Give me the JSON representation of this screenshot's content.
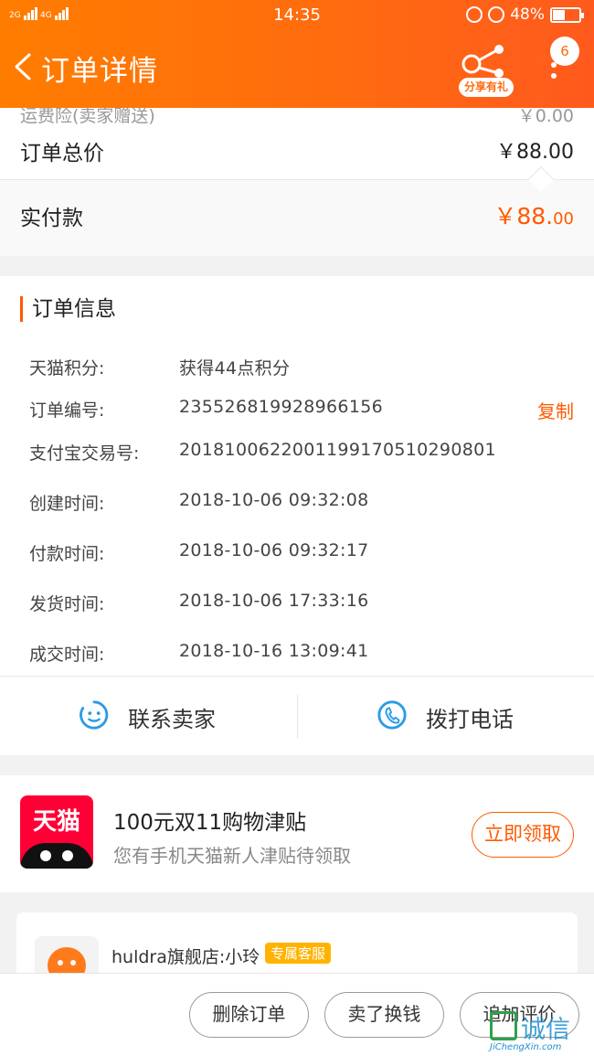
{
  "statusbar": {
    "net1": "2G",
    "net2": "4G",
    "time": "14:35",
    "battery": "48%",
    "battery_level": 0.48
  },
  "header": {
    "title": "订单详情",
    "share_label": "分享有礼",
    "badge_count": "6"
  },
  "price": {
    "freight_label": "运费险(卖家赠送)",
    "freight_amount": "￥0.00",
    "total_label": "订单总价",
    "total_amount": "￥88.00",
    "paid_label": "实付款",
    "paid_main": "￥88.",
    "paid_cents": "00"
  },
  "order_info": {
    "section_title": "订单信息",
    "copy_label": "复制",
    "rows": [
      {
        "key": "天猫积分:",
        "value": "获得44点积分"
      },
      {
        "key": "订单编号:",
        "value": "235526819928966156"
      },
      {
        "key": "支付宝交易号:",
        "value": "2018100622001199170510290801"
      },
      {
        "key": "创建时间:",
        "value": "2018-10-06 09:32:08"
      },
      {
        "key": "付款时间:",
        "value": "2018-10-06 09:32:17"
      },
      {
        "key": "发货时间:",
        "value": "2018-10-06 17:33:16"
      },
      {
        "key": "成交时间:",
        "value": "2018-10-16 13:09:41"
      }
    ],
    "contact_seller": "联系卖家",
    "call_phone": "拨打电话"
  },
  "promo": {
    "logo_text": "天猫",
    "title": "100元双11购物津贴",
    "subtitle": "您有手机天猫新人津贴待领取",
    "claim_label": "立即领取"
  },
  "chat": {
    "shop_name": "huldra旗舰店:小玲",
    "tag": "专属客服"
  },
  "actions": {
    "delete": "删除订单",
    "resell": "卖了换钱",
    "review": "追加评价"
  },
  "watermark": {
    "cn": "诚信",
    "en": "JiChengXin.com"
  },
  "colors": {
    "accent": "#ff5a00",
    "header_orange": "#ff7d00",
    "link_blue": "#2a9be8",
    "tmall_red": "#ff0036"
  }
}
